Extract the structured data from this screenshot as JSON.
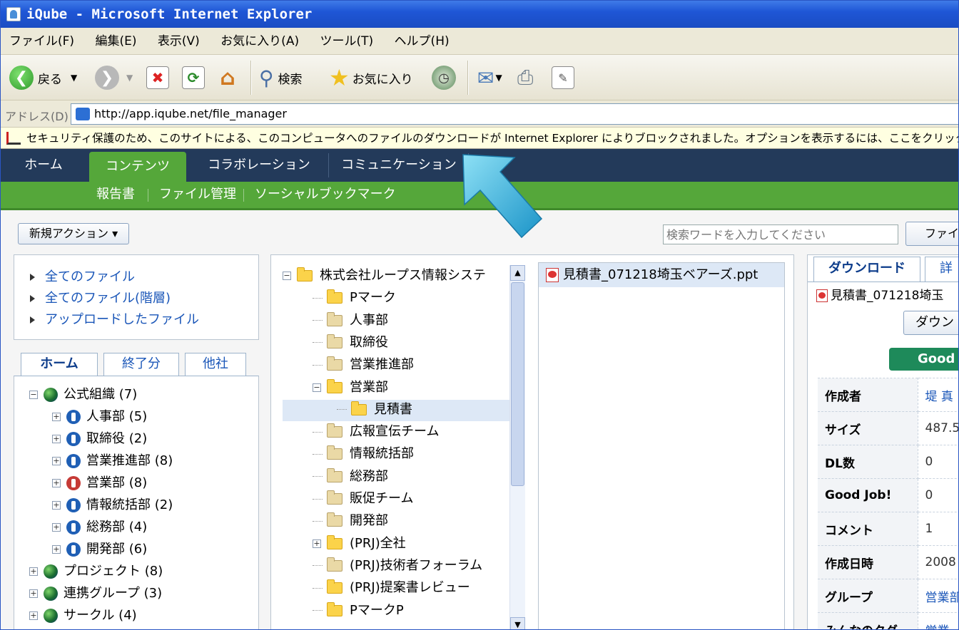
{
  "window": {
    "title": "iQube - Microsoft Internet Explorer"
  },
  "menu": [
    "ファイル(F)",
    "編集(E)",
    "表示(V)",
    "お気に入り(A)",
    "ツール(T)",
    "ヘルプ(H)"
  ],
  "toolbar": {
    "back": "戻る",
    "search": "検索",
    "favorites": "お気に入り"
  },
  "address": {
    "label": "アドレス(D)",
    "url": "http://app.iqube.net/file_manager"
  },
  "infobar": {
    "text": "セキュリティ保護のため、このサイトによる、このコンピュータへのファイルのダウンロードが Internet Explorer によりブロックされました。オプションを表示するには、ここをクリックしてください..."
  },
  "nav": {
    "tabs": [
      "ホーム",
      "コンテンツ",
      "コラボレーション",
      "コミュニケーション"
    ],
    "active": "コンテンツ",
    "sub": [
      "報告書",
      "ファイル管理",
      "ソーシャルブックマーク"
    ]
  },
  "actions": {
    "new_action": "新規アクション ▾",
    "search_placeholder": "検索ワードを入力してください",
    "file_button": "ファイ"
  },
  "filelinks": [
    "全てのファイル",
    "全てのファイル(階層)",
    "アップロードしたファイル"
  ],
  "left_tabs": [
    "ホーム",
    "終了分",
    "他社"
  ],
  "org_tree": [
    {
      "label": "公式組織 (7)",
      "level": 0,
      "toggle": "⊟",
      "icon": "globe"
    },
    {
      "label": "人事部 (5)",
      "level": 1,
      "toggle": "⊞",
      "icon": "org"
    },
    {
      "label": "取締役 (2)",
      "level": 1,
      "toggle": "⊞",
      "icon": "org"
    },
    {
      "label": "営業推進部 (8)",
      "level": 1,
      "toggle": "⊞",
      "icon": "org"
    },
    {
      "label": "営業部 (8)",
      "level": 1,
      "toggle": "⊞",
      "icon": "org-red"
    },
    {
      "label": "情報統括部 (2)",
      "level": 1,
      "toggle": "⊞",
      "icon": "org"
    },
    {
      "label": "総務部 (4)",
      "level": 1,
      "toggle": "⊞",
      "icon": "org"
    },
    {
      "label": "開発部 (6)",
      "level": 1,
      "toggle": "⊞",
      "icon": "org"
    },
    {
      "label": "プロジェクト (8)",
      "level": 0,
      "toggle": "⊞",
      "icon": "globe"
    },
    {
      "label": "連携グループ (3)",
      "level": 0,
      "toggle": "⊞",
      "icon": "globe"
    },
    {
      "label": "サークル (4)",
      "level": 0,
      "toggle": "⊞",
      "icon": "globe"
    }
  ],
  "folder_tree": [
    {
      "label": "株式会社ループス情報システ",
      "level": 0,
      "toggle": "⊟",
      "yellow": true
    },
    {
      "label": "Pマーク",
      "level": 1,
      "toggle": "",
      "yellow": true
    },
    {
      "label": "人事部",
      "level": 1,
      "toggle": "",
      "yellow": false
    },
    {
      "label": "取締役",
      "level": 1,
      "toggle": "",
      "yellow": false
    },
    {
      "label": "営業推進部",
      "level": 1,
      "toggle": "",
      "yellow": false
    },
    {
      "label": "営業部",
      "level": 1,
      "toggle": "⊟",
      "yellow": true
    },
    {
      "label": "見積書",
      "level": 2,
      "toggle": "",
      "yellow": true,
      "selected": true
    },
    {
      "label": "広報宣伝チーム",
      "level": 1,
      "toggle": "",
      "yellow": false
    },
    {
      "label": "情報統括部",
      "level": 1,
      "toggle": "",
      "yellow": false
    },
    {
      "label": "総務部",
      "level": 1,
      "toggle": "",
      "yellow": false
    },
    {
      "label": "販促チーム",
      "level": 1,
      "toggle": "",
      "yellow": false
    },
    {
      "label": "開発部",
      "level": 1,
      "toggle": "",
      "yellow": false
    },
    {
      "label": "(PRJ)全社",
      "level": 1,
      "toggle": "⊞",
      "yellow": true
    },
    {
      "label": "(PRJ)技術者フォーラム",
      "level": 1,
      "toggle": "",
      "yellow": false
    },
    {
      "label": "(PRJ)提案書レビュー",
      "level": 1,
      "toggle": "",
      "yellow": true
    },
    {
      "label": "PマークP",
      "level": 1,
      "toggle": "",
      "yellow": true
    }
  ],
  "files": [
    "見積書_071218埼玉ベアーズ.ppt"
  ],
  "detail": {
    "tabs": [
      "ダウンロード",
      "詳"
    ],
    "filename": "見積書_071218埼玉",
    "download_button": "ダウン",
    "good_button": "Good",
    "rows": [
      {
        "key": "作成者",
        "value": "堤 真",
        "link": true
      },
      {
        "key": "サイズ",
        "value": "487.5",
        "link": false
      },
      {
        "key": "DL数",
        "value": "0",
        "link": false
      },
      {
        "key": "Good Job!",
        "value": "0",
        "link": false
      },
      {
        "key": "コメント",
        "value": "1",
        "link": false
      },
      {
        "key": "作成日時",
        "value": "2008",
        "link": false
      },
      {
        "key": "グループ",
        "value": "営業部",
        "link": true
      },
      {
        "key": "みんなのタグ",
        "value": "営業",
        "link": true
      }
    ]
  },
  "colors": {
    "nav_dark": "#233a5a",
    "nav_green": "#55a73a",
    "link": "#1a56b8",
    "good": "#1e8a5a",
    "arrow": "#2aa8d8"
  }
}
